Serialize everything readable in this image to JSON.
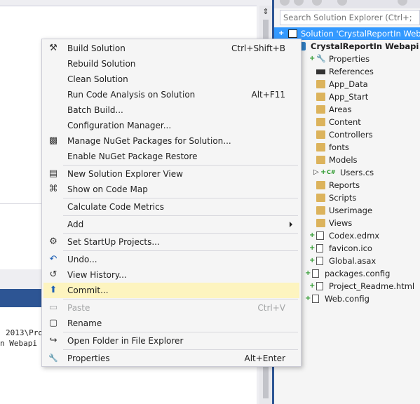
{
  "solution_explorer": {
    "search_placeholder": "Search Solution Explorer (Ctrl+;",
    "tree": [
      {
        "label": "Solution 'CrystalReportIn Weba",
        "icon": "solution-icon",
        "selected": true
      },
      {
        "label": "CrystalReportIn Webapi",
        "icon": "web-project-icon",
        "bold": true
      },
      {
        "label": "Properties",
        "icon": "wrench-icon"
      },
      {
        "label": "References",
        "icon": "references-icon"
      },
      {
        "label": "App_Data",
        "icon": "folder-icon"
      },
      {
        "label": "App_Start",
        "icon": "folder-icon"
      },
      {
        "label": "Areas",
        "icon": "folder-icon"
      },
      {
        "label": "Content",
        "icon": "folder-icon"
      },
      {
        "label": "Controllers",
        "icon": "folder-icon"
      },
      {
        "label": "fonts",
        "icon": "folder-icon"
      },
      {
        "label": "Models",
        "icon": "folder-icon"
      },
      {
        "label": "Users.cs",
        "icon": "csharp-file-icon",
        "badge": "C#"
      },
      {
        "label": "Reports",
        "icon": "folder-icon"
      },
      {
        "label": "Scripts",
        "icon": "folder-icon"
      },
      {
        "label": "Userimage",
        "icon": "folder-icon"
      },
      {
        "label": "Views",
        "icon": "folder-icon"
      },
      {
        "label": "Codex.edmx",
        "icon": "edmx-file-icon"
      },
      {
        "label": "favicon.ico",
        "icon": "file-icon"
      },
      {
        "label": "Global.asax",
        "icon": "file-icon"
      },
      {
        "label": "packages.config",
        "icon": "config-file-icon"
      },
      {
        "label": "Project_Readme.html",
        "icon": "html-file-icon"
      },
      {
        "label": "Web.config",
        "icon": "config-file-icon"
      }
    ]
  },
  "output": {
    "line1": "2013\\Pro",
    "line2": "n Webapi"
  },
  "context_menu": {
    "items": [
      {
        "label": "Build Solution",
        "shortcut": "Ctrl+Shift+B",
        "icon": "build-icon",
        "glyph": "⚒"
      },
      {
        "label": "Rebuild Solution",
        "shortcut": "",
        "icon": "",
        "glyph": ""
      },
      {
        "label": "Clean Solution",
        "shortcut": "",
        "icon": "",
        "glyph": ""
      },
      {
        "label": "Run Code Analysis on Solution",
        "shortcut": "Alt+F11",
        "icon": "",
        "glyph": ""
      },
      {
        "label": "Batch Build...",
        "shortcut": "",
        "icon": "",
        "glyph": ""
      },
      {
        "label": "Configuration Manager...",
        "shortcut": "",
        "icon": "",
        "glyph": ""
      },
      {
        "label": "Manage NuGet Packages for Solution...",
        "shortcut": "",
        "icon": "nuget-icon",
        "glyph": "▩"
      },
      {
        "label": "Enable NuGet Package Restore",
        "shortcut": "",
        "icon": "",
        "glyph": ""
      },
      {
        "label": "New Solution Explorer View",
        "shortcut": "",
        "icon": "new-view-icon",
        "glyph": "▤"
      },
      {
        "label": "Show on Code Map",
        "shortcut": "",
        "icon": "code-map-icon",
        "glyph": "⌘"
      },
      {
        "label": "Calculate Code Metrics",
        "shortcut": "",
        "icon": "",
        "glyph": ""
      },
      {
        "label": "Add",
        "shortcut": "",
        "icon": "",
        "glyph": "",
        "submenu": true
      },
      {
        "label": "Set StartUp Projects...",
        "shortcut": "",
        "icon": "gear-icon",
        "glyph": "⚙"
      },
      {
        "label": "Undo...",
        "shortcut": "",
        "icon": "undo-icon",
        "glyph": "↶"
      },
      {
        "label": "View History...",
        "shortcut": "",
        "icon": "history-icon",
        "glyph": "↺"
      },
      {
        "label": "Commit...",
        "shortcut": "",
        "icon": "commit-icon",
        "glyph": "⬆",
        "highlighted": true
      },
      {
        "label": "Paste",
        "shortcut": "Ctrl+V",
        "icon": "paste-icon",
        "glyph": "▭",
        "disabled": true
      },
      {
        "label": "Rename",
        "shortcut": "",
        "icon": "rename-icon",
        "glyph": "▢"
      },
      {
        "label": "Open Folder in File Explorer",
        "shortcut": "",
        "icon": "open-folder-icon",
        "glyph": "↪"
      },
      {
        "label": "Properties",
        "shortcut": "Alt+Enter",
        "icon": "wrench-icon",
        "glyph": "🔧"
      }
    ]
  }
}
